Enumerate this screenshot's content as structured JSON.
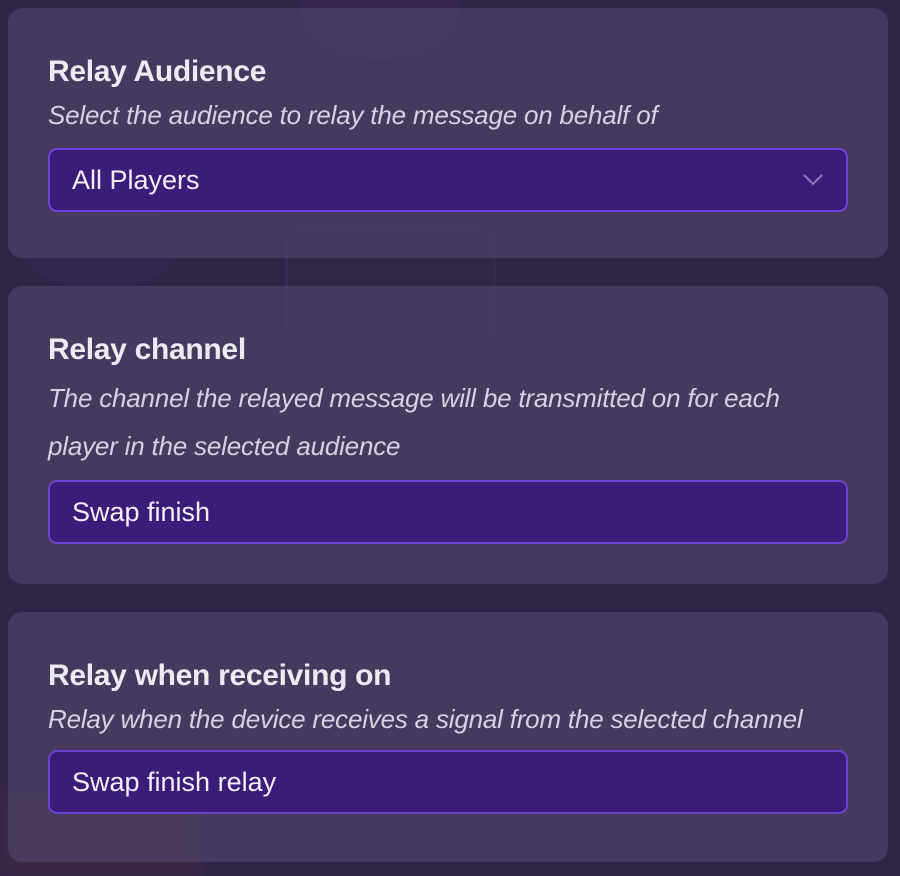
{
  "relay_audience": {
    "title": "Relay Audience",
    "description": "Select the audience to relay the message on behalf of",
    "selected_value": "All Players"
  },
  "relay_channel": {
    "title": "Relay channel",
    "description": "The channel the relayed message will be transmitted on for each player in the selected audience",
    "value": "Swap finish"
  },
  "relay_receiving": {
    "title": "Relay when receiving on",
    "description": "Relay when the device receives a signal from the selected channel",
    "value": "Swap finish relay"
  },
  "colors": {
    "field_background": "#3b1c78",
    "field_border": "#6a42d6",
    "card_background": "#4a3f64",
    "page_background": "#2f2446"
  },
  "icons": {
    "dropdown": "chevron-down-icon"
  }
}
